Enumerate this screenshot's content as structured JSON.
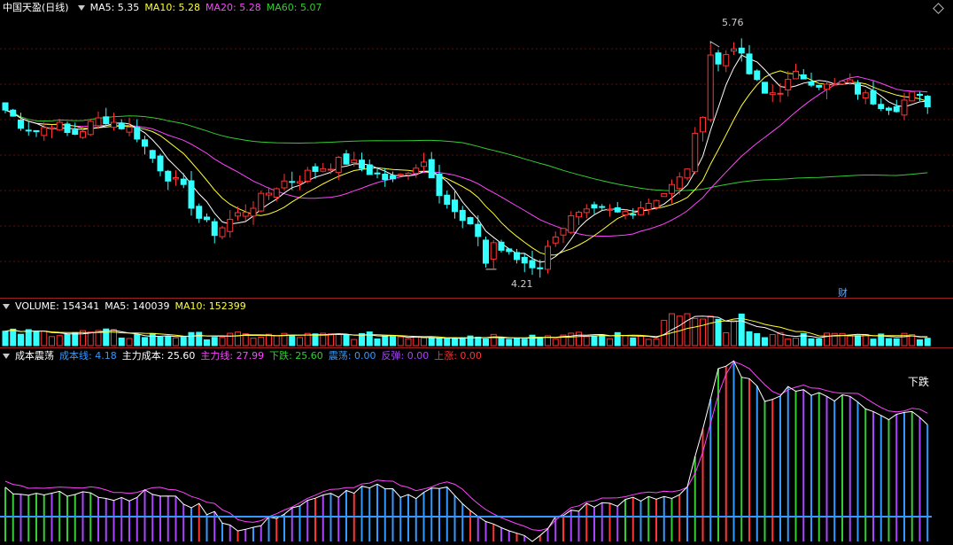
{
  "price_panel": {
    "title": "中国天盈(日线)",
    "ma": [
      {
        "label": "MA5: 5.35",
        "color": "#ffffff"
      },
      {
        "label": "MA10: 5.28",
        "color": "#ffff33"
      },
      {
        "label": "MA20: 5.28",
        "color": "#ff44ff"
      },
      {
        "label": "MA60: 5.07",
        "color": "#33cc33"
      }
    ],
    "high_label": "5.76",
    "low_label": "4.21",
    "badge": "财"
  },
  "volume_panel": {
    "title": "VOLUME: 154341",
    "ma5": "MA5: 140039",
    "ma10": "MA10: 152399"
  },
  "osc_panel": {
    "title": "成本震荡",
    "items": [
      {
        "label": "成本线: 4.18",
        "color": "#3399ff"
      },
      {
        "label": "主力成本: 25.60",
        "color": "#ffffff"
      },
      {
        "label": "主力线: 27.99",
        "color": "#ff44ff"
      },
      {
        "label": "下跌: 25.60",
        "color": "#33cc33"
      },
      {
        "label": "震荡: 0.00",
        "color": "#3399ff"
      },
      {
        "label": "反弹: 0.00",
        "color": "#aa44ff"
      },
      {
        "label": "上涨: 0.00",
        "color": "#ff3333"
      }
    ],
    "signal": "下跌"
  },
  "chart_data": {
    "type": "candlestick",
    "stock": "中国天盈",
    "period": "日线",
    "price_close_points": [
      5.3,
      5.2,
      5.15,
      5.22,
      5.12,
      5.18,
      5.25,
      5.2,
      5.15,
      4.98,
      4.85,
      4.75,
      4.55,
      4.45,
      4.55,
      4.62,
      4.7,
      4.8,
      4.82,
      4.88,
      4.92,
      4.95,
      4.9,
      4.85,
      4.8,
      4.9,
      4.95,
      4.7,
      4.55,
      4.45,
      4.4,
      4.3,
      4.25,
      4.21,
      4.45,
      4.55,
      4.58,
      4.6,
      4.58,
      4.62,
      4.68,
      4.75,
      4.85,
      5.25,
      5.6,
      5.76,
      5.55,
      5.4,
      5.45,
      5.55,
      5.5,
      5.45,
      5.5,
      5.4,
      5.35,
      5.32,
      5.4,
      5.35
    ],
    "high": 5.76,
    "low": 4.21,
    "ma_final": {
      "MA5": 5.35,
      "MA10": 5.28,
      "MA20": 5.28,
      "MA60": 5.07
    },
    "volume_final": {
      "VOLUME": 154341,
      "MA5": 140039,
      "MA10": 152399
    },
    "osc_final": {
      "成本线": 4.18,
      "主力成本": 25.6,
      "主力线": 27.99
    }
  }
}
